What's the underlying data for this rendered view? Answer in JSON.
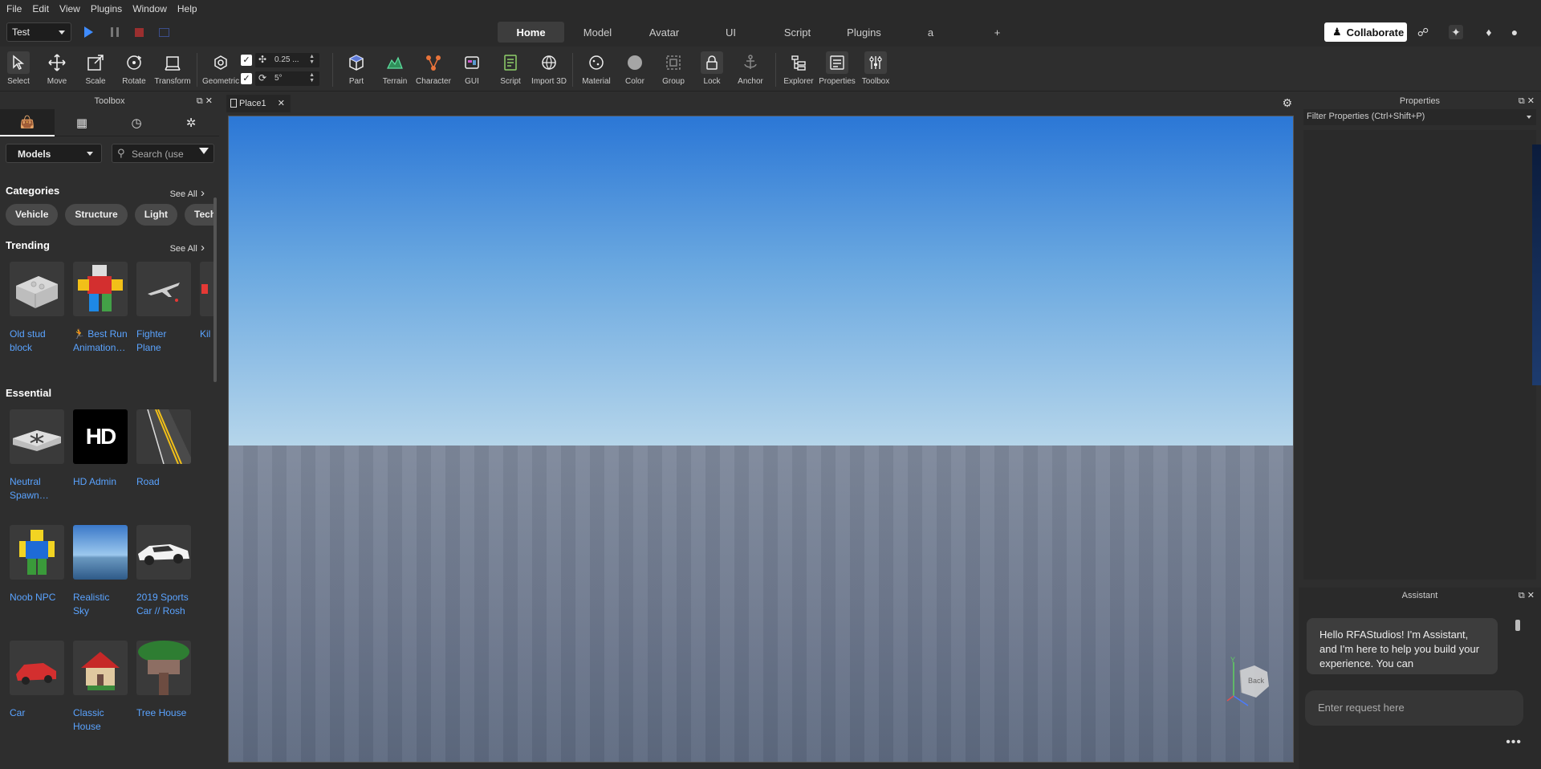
{
  "menu": [
    "File",
    "Edit",
    "View",
    "Plugins",
    "Window",
    "Help"
  ],
  "topbar": {
    "test_mode": "Test",
    "tabs": [
      "Home",
      "Model",
      "Avatar",
      "UI",
      "Script",
      "Plugins",
      "a",
      "+"
    ],
    "active_tab": "Home",
    "collaborate_label": "Collaborate"
  },
  "ribbon": {
    "tools_left": [
      "Select",
      "Move",
      "Scale",
      "Rotate",
      "Transform",
      "Geometric"
    ],
    "snap_move": "0.25 ...",
    "snap_rotate": "5°",
    "tools_insert": [
      "Part",
      "Terrain",
      "Character",
      "GUI",
      "Script",
      "Import 3D"
    ],
    "tools_edit": [
      "Material",
      "Color",
      "Group",
      "Lock",
      "Anchor"
    ],
    "tools_view": [
      "Explorer",
      "Properties",
      "Toolbox"
    ]
  },
  "toolbox": {
    "title": "Toolbox",
    "category_dropdown": "Models",
    "search_placeholder": "Search (use",
    "categories_title": "Categories",
    "see_all": "See All",
    "categories": [
      "Vehicle",
      "Structure",
      "Light",
      "Tech"
    ],
    "trending_title": "Trending",
    "trending": [
      "Old stud block",
      "🏃 Best Run Animation…",
      "Fighter Plane",
      "Kil Ob"
    ],
    "essential_title": "Essential",
    "essential_row1": [
      "Neutral Spawn…",
      "HD Admin",
      "Road"
    ],
    "essential_row2": [
      "Noob NPC",
      "Realistic Sky",
      "2019 Sports Car // Rosh"
    ],
    "essential_row3": [
      "Car",
      "Classic House",
      "Tree House"
    ],
    "hd_admin_logo": "HD"
  },
  "viewport": {
    "doc_tab": "Place1",
    "gizmo_label": "Back",
    "gizmo_axis": "Y"
  },
  "properties": {
    "title": "Properties",
    "filter_placeholder": "Filter Properties (Ctrl+Shift+P)"
  },
  "assistant": {
    "title": "Assistant",
    "message": "Hello RFAStudios! I'm Assistant, and I'm here to help you build your experience. You can",
    "input_placeholder": "Enter request here",
    "more": "•••"
  },
  "colors": {
    "accent_blue": "#3f8cff",
    "link_blue": "#5aa3ff",
    "panel_bg": "#2e2e2e",
    "stop_red": "#9b2f2f"
  }
}
